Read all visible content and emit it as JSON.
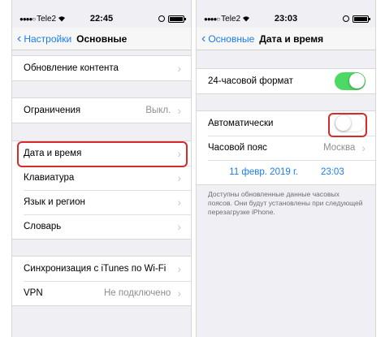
{
  "left_screen": {
    "status": {
      "carrier": "Tele2",
      "time": "22:45"
    },
    "nav": {
      "back_label": "Настройки",
      "title": "Основные"
    },
    "group1": [
      {
        "label": "Обновление контента"
      }
    ],
    "group2": [
      {
        "label": "Ограничения",
        "value": "Выкл."
      }
    ],
    "group3": [
      {
        "label": "Дата и время"
      },
      {
        "label": "Клавиатура"
      },
      {
        "label": "Язык и регион"
      },
      {
        "label": "Словарь"
      }
    ],
    "group4": [
      {
        "label": "Синхронизация с iTunes по Wi-Fi"
      },
      {
        "label": "VPN",
        "value": "Не подключено"
      }
    ]
  },
  "right_screen": {
    "status": {
      "carrier": "Tele2",
      "time": "23:03"
    },
    "nav": {
      "back_label": "Основные",
      "title": "Дата и время"
    },
    "format_24h": {
      "label": "24-часовой формат",
      "on": true
    },
    "auto": {
      "label": "Автоматически",
      "on": false
    },
    "timezone": {
      "label": "Часовой пояс",
      "value": "Москва"
    },
    "date": "11 февр. 2019 г.",
    "time": "23:03",
    "footnote": "Доступны обновленные данные часовых поясов. Они будут установлены при следующей перезагрузке iPhone."
  },
  "colors": {
    "accent": "#1a7cf5",
    "toggle_on": "#4cd964",
    "highlight": "#d62b2b"
  },
  "icons": {
    "signal": "signal-dots-icon",
    "wifi": "wifi-icon",
    "battery": "battery-icon",
    "rotation_lock": "rotation-lock-icon",
    "back": "chevron-left-icon",
    "row": "chevron-right-icon"
  }
}
